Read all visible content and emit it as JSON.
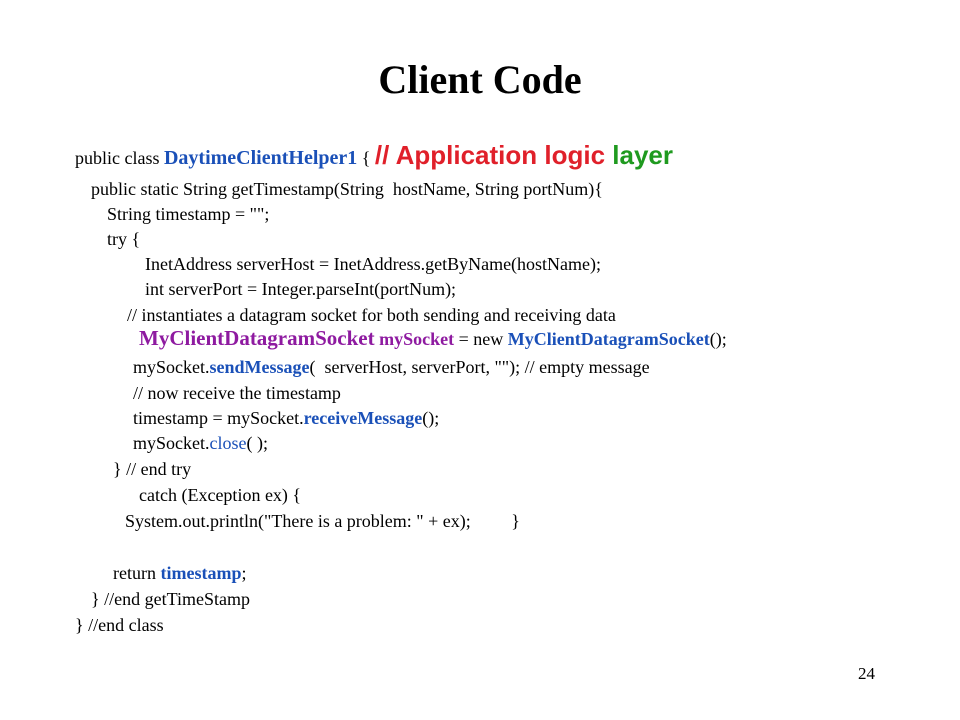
{
  "slide": {
    "title": "Client Code",
    "page_number": "24"
  },
  "code": {
    "l1": [
      "public class ",
      "DaytimeClientHelper1",
      " { ",
      "// Application logic",
      " layer"
    ],
    "l2": [
      "public static String getTimestamp(String  hostName, String portNum){"
    ],
    "l3": [
      "String timestamp = \"\";"
    ],
    "l4": [
      "try {"
    ],
    "l5": [
      "InetAddress serverHost = InetAddress.getByName(hostName);"
    ],
    "l6": [
      "int serverPort = Integer.parseInt(portNum);"
    ],
    "l7": [
      "// instantiates a datagram socket for both sending and receiving data"
    ],
    "l8": [
      "MyClientDatagramSocket",
      " ",
      "mySocket",
      " = new ",
      "MyClientDatagramSocket",
      "();"
    ],
    "l9": [
      "mySocket.",
      "sendMessage",
      "(  serverHost, serverPort, \"\"); // empty message"
    ],
    "l10": [
      "// now receive the timestamp"
    ],
    "l11": [
      "timestamp = mySocket.",
      "receiveMessage",
      "();"
    ],
    "l12": [
      "mySocket.",
      "close",
      "( );"
    ],
    "l13": [
      "} // end try"
    ],
    "l14": [
      "catch (Exception ex) {"
    ],
    "l15": [
      "System.out.println(\"There is a problem: \" + ex);",
      "         }"
    ],
    "l16": [
      "return ",
      "timestamp",
      ";"
    ],
    "l17": [
      "} //end getTimeStamp"
    ],
    "l18": [
      "} //end class"
    ]
  },
  "colors": {
    "keyword_blue": "#1a50b8",
    "class_purple": "#8e1aa0",
    "comment_red": "#e0202a",
    "comment_green": "#1f9a1f",
    "text_black": "#000000",
    "background": "#ffffff"
  }
}
